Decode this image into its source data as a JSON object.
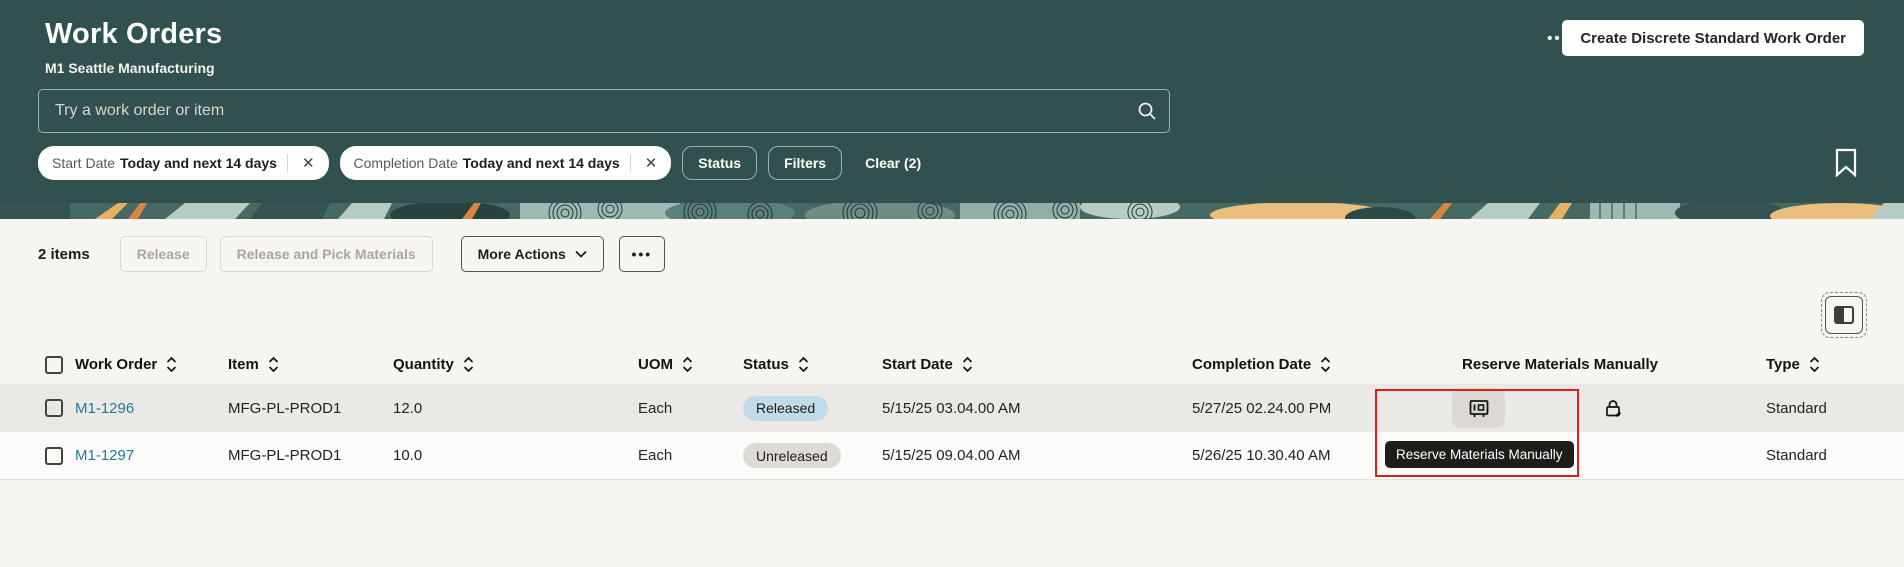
{
  "colors": {
    "header_bg": "#30514f",
    "page_bg": "#f7f5f2",
    "link": "#21789e",
    "released_badge_bg": "#c1dbe8",
    "unreleased_badge_bg": "#dedbd6",
    "annotation_red": "#e01e1e",
    "tooltip_bg": "#1f1d1a",
    "row_hover_bg": "#ebe9e5",
    "row_bg": "#fcfbf9"
  },
  "icons": {
    "ellipsis": "•••",
    "close": "✕"
  },
  "header": {
    "title": "Work Orders",
    "subtitle": "M1 Seattle Manufacturing",
    "create_button": "Create Discrete Standard Work Order",
    "search_placeholder": "Try a work order or item",
    "chips": [
      {
        "label": "Start Date",
        "value": "Today and next 14 days"
      },
      {
        "label": "Completion Date",
        "value": "Today and next 14 days"
      }
    ],
    "status_button": "Status",
    "filters_button": "Filters",
    "clear_label": "Clear (2)"
  },
  "toolbar": {
    "items_count": "2 items",
    "release_label": "Release",
    "release_pick_label": "Release and Pick Materials",
    "more_actions_label": "More Actions"
  },
  "table": {
    "columns": [
      {
        "label": "Work Order"
      },
      {
        "label": "Item"
      },
      {
        "label": "Quantity"
      },
      {
        "label": "UOM"
      },
      {
        "label": "Status"
      },
      {
        "label": "Start Date"
      },
      {
        "label": "Completion Date"
      },
      {
        "label": "Reserve Materials Manually"
      },
      {
        "label": "Type"
      }
    ],
    "rows": [
      {
        "work_order": "M1-1296",
        "item": "MFG-PL-PROD1",
        "quantity": "12.0",
        "uom": "Each",
        "status": "Released",
        "start_date": "5/15/25 03.04.00 AM",
        "completion_date": "5/27/25 02.24.00 PM",
        "type": "Standard"
      },
      {
        "work_order": "M1-1297",
        "item": "MFG-PL-PROD1",
        "quantity": "10.0",
        "uom": "Each",
        "status": "Unreleased",
        "start_date": "5/15/25 09.04.00 AM",
        "completion_date": "5/26/25 10.30.40 AM",
        "type": "Standard"
      }
    ],
    "tooltip": "Reserve Materials Manually"
  }
}
